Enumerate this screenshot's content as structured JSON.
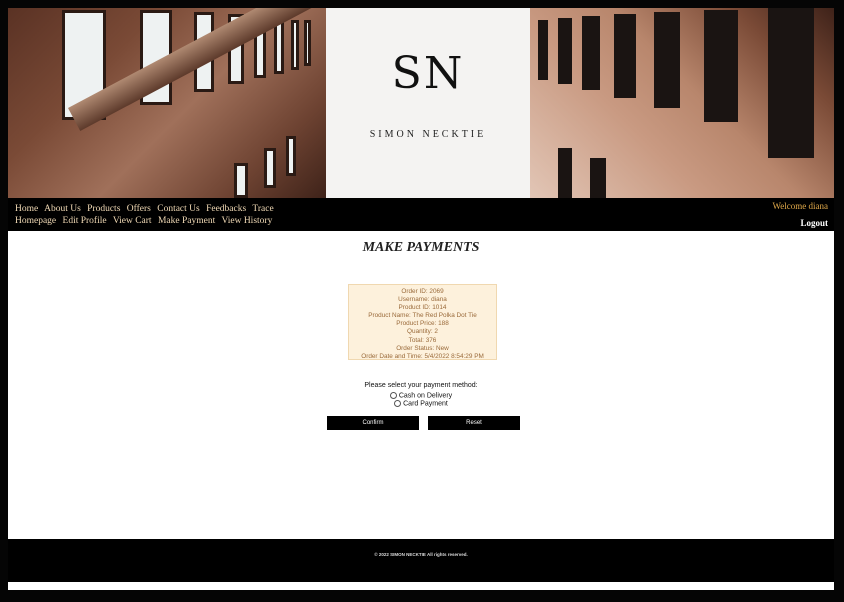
{
  "brand": {
    "monogram": "SN",
    "name": "SIMON NECKTIE"
  },
  "nav": {
    "row1": [
      "Home",
      "About Us",
      "Products",
      "Offers",
      "Contact Us",
      "Feedbacks",
      "Trace"
    ],
    "row2": [
      "Homepage",
      "Edit Profile",
      "View Cart",
      "Make Payment",
      "View History"
    ],
    "welcome": "Welcome diana",
    "logout": "Logout"
  },
  "page": {
    "title": "MAKE PAYMENTS"
  },
  "order": {
    "lines": [
      "Order ID: 2069",
      "Username: diana",
      "Product ID: 1014",
      "Product Name: The Red Polka Dot Tie",
      "Product Price: 188",
      "Quantity: 2",
      "Total: 376",
      "Order Status: New",
      "Order Date and Time: 5/4/2022 8:54:29 PM"
    ]
  },
  "payment": {
    "prompt": "Please select your payment method:",
    "options": [
      "Cash on Delivery",
      "Card Payment"
    ],
    "confirm_label": "Confirm",
    "reset_label": "Reset"
  },
  "footer": {
    "text": "© 2022 SIMON NECKTIE All rights reserved."
  },
  "colors": {
    "nav_link": "#f0d9b5",
    "welcome": "#e0a94a",
    "order_text": "#9a6a3a",
    "order_bg": "#fdf1dc"
  }
}
